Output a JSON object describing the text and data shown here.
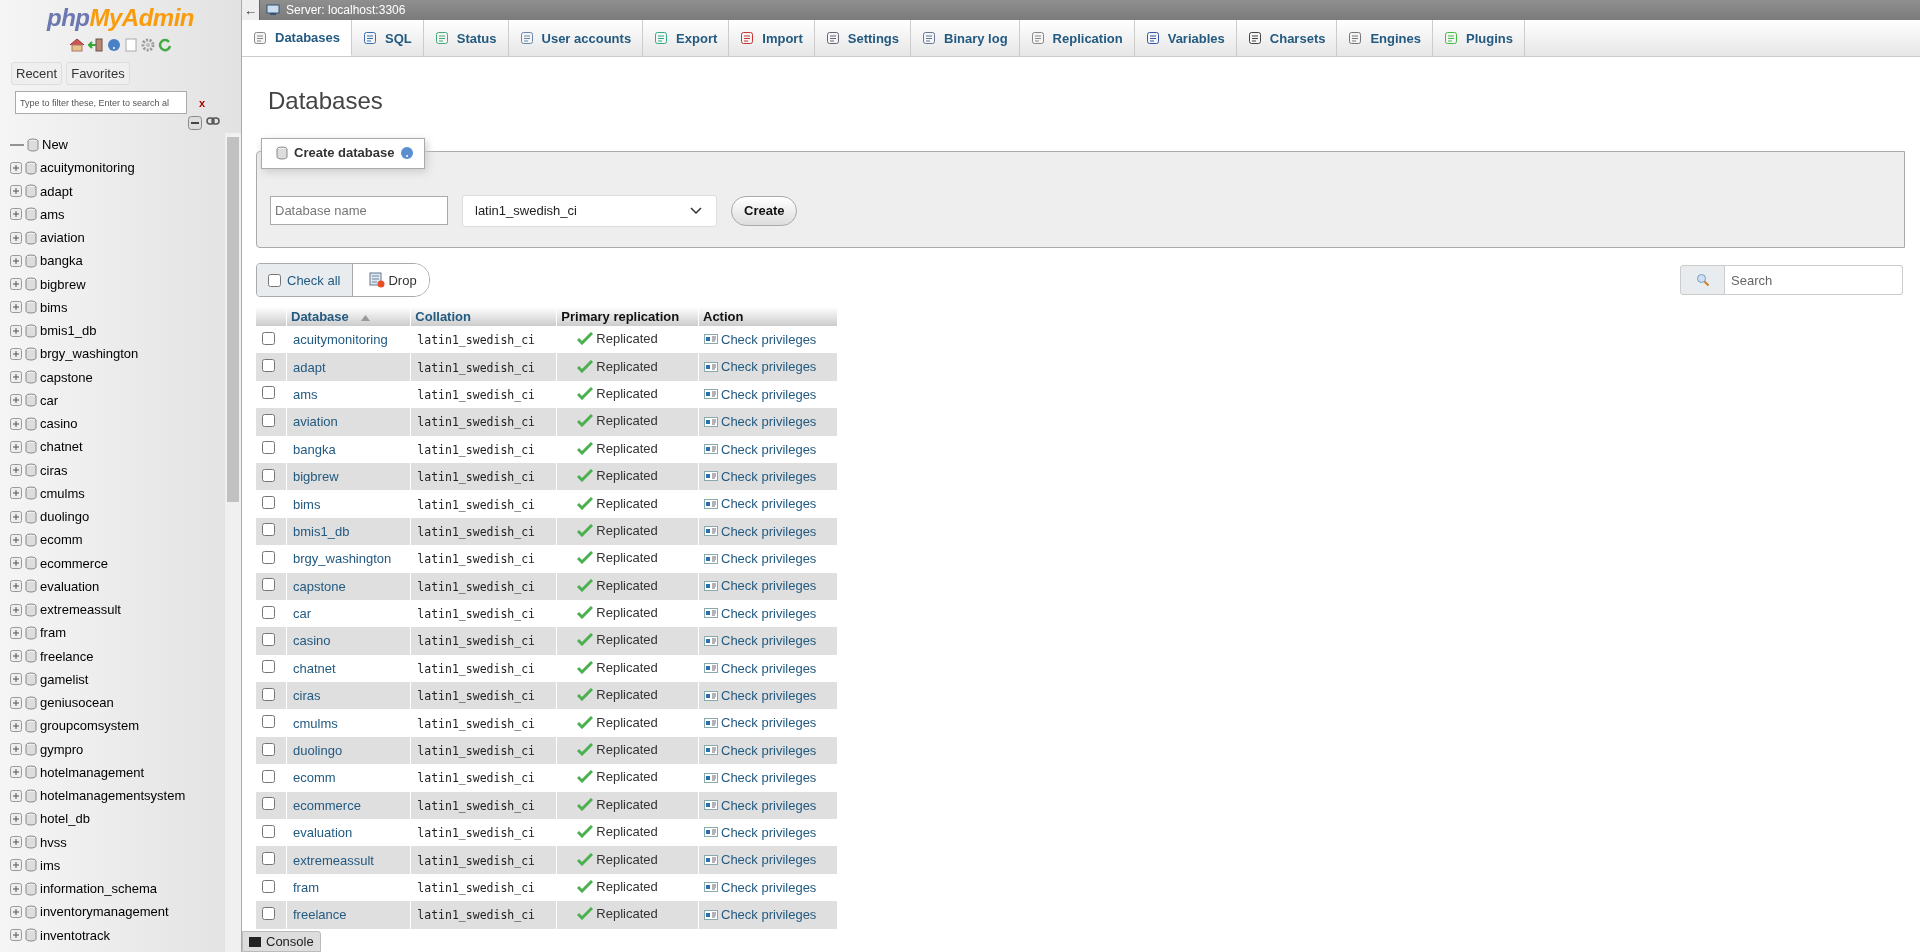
{
  "sidebar": {
    "logo": {
      "prefix": "php",
      "suffix": "MyAdmin"
    },
    "tabs": [
      {
        "label": "Recent"
      },
      {
        "label": "Favorites"
      }
    ],
    "filter": {
      "placeholder": "Type to filter these, Enter to search al",
      "clear": "x"
    },
    "new_item": "New",
    "databases": [
      {
        "name": "acuitymonitoring",
        "expanded": false
      },
      {
        "name": "adapt",
        "expanded": false
      },
      {
        "name": "ams",
        "expanded": false
      },
      {
        "name": "aviation",
        "expanded": false
      },
      {
        "name": "bangka",
        "expanded": false
      },
      {
        "name": "bigbrew",
        "expanded": false
      },
      {
        "name": "bims",
        "expanded": false
      },
      {
        "name": "bmis1_db",
        "expanded": false
      },
      {
        "name": "brgy_washington",
        "expanded": false
      },
      {
        "name": "capstone",
        "expanded": false
      },
      {
        "name": "car",
        "expanded": false
      },
      {
        "name": "casino",
        "expanded": false
      },
      {
        "name": "chatnet",
        "expanded": false
      },
      {
        "name": "ciras",
        "expanded": false
      },
      {
        "name": "cmulms",
        "expanded": false
      },
      {
        "name": "duolingo",
        "expanded": false
      },
      {
        "name": "ecomm",
        "expanded": false
      },
      {
        "name": "ecommerce",
        "expanded": false
      },
      {
        "name": "evaluation",
        "expanded": false
      },
      {
        "name": "extremeassult",
        "expanded": false
      },
      {
        "name": "fram",
        "expanded": false
      },
      {
        "name": "freelance",
        "expanded": false
      },
      {
        "name": "gamelist",
        "expanded": false
      },
      {
        "name": "geniusocean",
        "expanded": false
      },
      {
        "name": "groupcomsystem",
        "expanded": false
      },
      {
        "name": "gympro",
        "expanded": false
      },
      {
        "name": "hotelmanagement",
        "expanded": false
      },
      {
        "name": "hotelmanagementsystem",
        "expanded": false
      },
      {
        "name": "hotel_db",
        "expanded": false
      },
      {
        "name": "hvss",
        "expanded": false
      },
      {
        "name": "ims",
        "expanded": false
      },
      {
        "name": "information_schema",
        "expanded": false
      },
      {
        "name": "inventorymanagement",
        "expanded": false
      },
      {
        "name": "inventotrack",
        "expanded": false
      }
    ]
  },
  "server_bar": {
    "collapse": "←",
    "title": "Server: localhost:3306"
  },
  "tabs": [
    {
      "label": "Databases",
      "selected": true
    },
    {
      "label": "SQL",
      "selected": false
    },
    {
      "label": "Status",
      "selected": false
    },
    {
      "label": "User accounts",
      "selected": false
    },
    {
      "label": "Export",
      "selected": false
    },
    {
      "label": "Import",
      "selected": false
    },
    {
      "label": "Settings",
      "selected": false
    },
    {
      "label": "Binary log",
      "selected": false
    },
    {
      "label": "Replication",
      "selected": false
    },
    {
      "label": "Variables",
      "selected": false
    },
    {
      "label": "Charsets",
      "selected": false
    },
    {
      "label": "Engines",
      "selected": false
    },
    {
      "label": "Plugins",
      "selected": false
    }
  ],
  "heading": "Databases",
  "create_database": {
    "legend": "Create database",
    "name_field": {
      "placeholder": "Database name"
    },
    "collation": "latin1_swedish_ci",
    "button": "Create"
  },
  "bulk": {
    "check_all": {
      "label": "Check all",
      "checked": false
    },
    "drop": "Drop"
  },
  "search": {
    "placeholder": "Search"
  },
  "table": {
    "columns": [
      {
        "label": "Database",
        "sorted": true
      },
      {
        "label": "Collation",
        "sorted": false
      },
      {
        "label": "Primary replication",
        "sorted": false
      },
      {
        "label": "Action",
        "sorted": false
      }
    ],
    "rows": [
      {
        "checked": false,
        "name": "acuitymonitoring",
        "collation": "latin1_swedish_ci",
        "replication": "Replicated",
        "action": "Check privileges"
      },
      {
        "checked": false,
        "name": "adapt",
        "collation": "latin1_swedish_ci",
        "replication": "Replicated",
        "action": "Check privileges"
      },
      {
        "checked": false,
        "name": "ams",
        "collation": "latin1_swedish_ci",
        "replication": "Replicated",
        "action": "Check privileges"
      },
      {
        "checked": false,
        "name": "aviation",
        "collation": "latin1_swedish_ci",
        "replication": "Replicated",
        "action": "Check privileges"
      },
      {
        "checked": false,
        "name": "bangka",
        "collation": "latin1_swedish_ci",
        "replication": "Replicated",
        "action": "Check privileges"
      },
      {
        "checked": false,
        "name": "bigbrew",
        "collation": "latin1_swedish_ci",
        "replication": "Replicated",
        "action": "Check privileges"
      },
      {
        "checked": false,
        "name": "bims",
        "collation": "latin1_swedish_ci",
        "replication": "Replicated",
        "action": "Check privileges"
      },
      {
        "checked": false,
        "name": "bmis1_db",
        "collation": "latin1_swedish_ci",
        "replication": "Replicated",
        "action": "Check privileges"
      },
      {
        "checked": false,
        "name": "brgy_washington",
        "collation": "latin1_swedish_ci",
        "replication": "Replicated",
        "action": "Check privileges"
      },
      {
        "checked": false,
        "name": "capstone",
        "collation": "latin1_swedish_ci",
        "replication": "Replicated",
        "action": "Check privileges"
      },
      {
        "checked": false,
        "name": "car",
        "collation": "latin1_swedish_ci",
        "replication": "Replicated",
        "action": "Check privileges"
      },
      {
        "checked": false,
        "name": "casino",
        "collation": "latin1_swedish_ci",
        "replication": "Replicated",
        "action": "Check privileges"
      },
      {
        "checked": false,
        "name": "chatnet",
        "collation": "latin1_swedish_ci",
        "replication": "Replicated",
        "action": "Check privileges"
      },
      {
        "checked": false,
        "name": "ciras",
        "collation": "latin1_swedish_ci",
        "replication": "Replicated",
        "action": "Check privileges"
      },
      {
        "checked": false,
        "name": "cmulms",
        "collation": "latin1_swedish_ci",
        "replication": "Replicated",
        "action": "Check privileges"
      },
      {
        "checked": false,
        "name": "duolingo",
        "collation": "latin1_swedish_ci",
        "replication": "Replicated",
        "action": "Check privileges"
      },
      {
        "checked": false,
        "name": "ecomm",
        "collation": "latin1_swedish_ci",
        "replication": "Replicated",
        "action": "Check privileges"
      },
      {
        "checked": false,
        "name": "ecommerce",
        "collation": "latin1_swedish_ci",
        "replication": "Replicated",
        "action": "Check privileges"
      },
      {
        "checked": false,
        "name": "evaluation",
        "collation": "latin1_swedish_ci",
        "replication": "Replicated",
        "action": "Check privileges"
      },
      {
        "checked": false,
        "name": "extremeassult",
        "collation": "latin1_swedish_ci",
        "replication": "Replicated",
        "action": "Check privileges"
      },
      {
        "checked": false,
        "name": "fram",
        "collation": "latin1_swedish_ci",
        "replication": "Replicated",
        "action": "Check privileges"
      },
      {
        "checked": false,
        "name": "freelance",
        "collation": "latin1_swedish_ci",
        "replication": "Replicated",
        "action": "Check privileges"
      }
    ]
  },
  "console": {
    "label": "Console"
  }
}
